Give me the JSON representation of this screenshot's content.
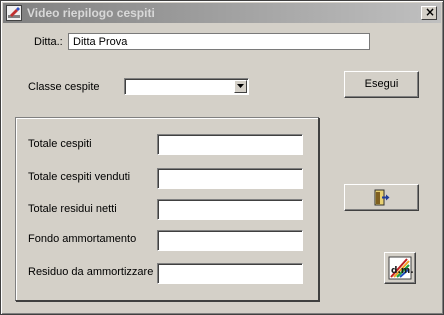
{
  "window": {
    "title": "Video riepilogo cespiti",
    "close_glyph": "×"
  },
  "form": {
    "ditta_label": "Ditta.:",
    "ditta_value": "Ditta Prova",
    "classe_label": "Classe cespite",
    "classe_value": "",
    "esegui_label": "Esegui"
  },
  "totals": {
    "totale_cespiti_label": "Totale cespiti",
    "totale_cespiti_value": "",
    "totale_venduti_label": "Totale cespiti venduti",
    "totale_venduti_value": "",
    "totale_residui_label": "Totale residui netti",
    "totale_residui_value": "",
    "fondo_label": "Fondo ammortamento",
    "fondo_value": "",
    "residuo_label": "Residuo da ammortizzare",
    "residuo_value": ""
  },
  "icons": {
    "app": "app-icon",
    "exit": "exit-door-icon",
    "dm": "dm-logo-icon",
    "dm_text": "d.m."
  },
  "colors": {
    "face": "#d4d0c8",
    "titlebar_start": "#808080",
    "titlebar_end": "#c0c0c0",
    "exit_accent": "#1e3c9c"
  }
}
